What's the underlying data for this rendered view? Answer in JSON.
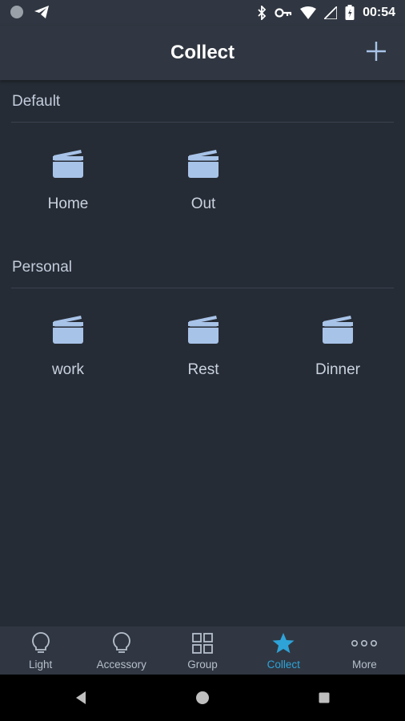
{
  "status": {
    "time": "00:54"
  },
  "appbar": {
    "title": "Collect"
  },
  "sections": [
    {
      "title": "Default",
      "scenes": [
        {
          "label": "Home"
        },
        {
          "label": "Out"
        }
      ]
    },
    {
      "title": "Personal",
      "scenes": [
        {
          "label": "work"
        },
        {
          "label": "Rest"
        },
        {
          "label": "Dinner"
        }
      ]
    }
  ],
  "tabs": [
    {
      "label": "Light",
      "icon": "bulb-icon"
    },
    {
      "label": "Accessory",
      "icon": "bulb-icon"
    },
    {
      "label": "Group",
      "icon": "grid-icon"
    },
    {
      "label": "Collect",
      "icon": "star-icon",
      "active": true
    },
    {
      "label": "More",
      "icon": "more-dots-icon"
    }
  ],
  "colors": {
    "accent": "#2ea3d8",
    "background": "#262c35",
    "bar": "#303742",
    "icon": "#a8c3e8"
  }
}
